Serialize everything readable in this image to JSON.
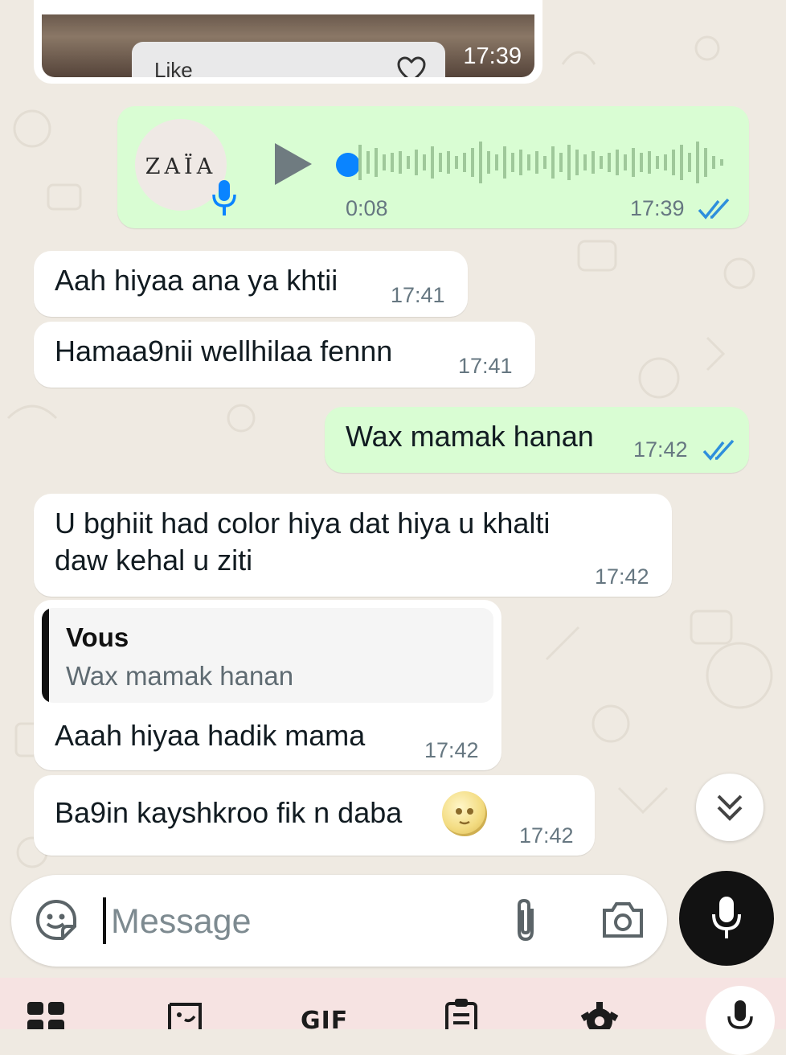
{
  "colors": {
    "chat_bg": "#efeae2",
    "incoming_bubble": "#ffffff",
    "outgoing_bubble": "#d9fdd3",
    "read_ticks": "#53bdeb",
    "voice_progress_dot": "#0a84ff",
    "mic_button": "#121212"
  },
  "image_message": {
    "like_label": "Like",
    "time": "17:39"
  },
  "voice_message": {
    "avatar_text": "ZAÏA",
    "duration": "0:08",
    "time": "17:39",
    "status": "read"
  },
  "messages": [
    {
      "direction": "in",
      "text": "Aah hiyaa ana ya khtii",
      "time": "17:41"
    },
    {
      "direction": "in",
      "text": "Hamaa9nii wellhilaa fennn",
      "time": "17:41"
    },
    {
      "direction": "out",
      "text": "Wax mamak hanan",
      "time": "17:42",
      "status": "read"
    },
    {
      "direction": "in",
      "text_line1": "U bghiit had color hiya dat hiya u khalti",
      "text_line2": "daw kehal u ziti",
      "time": "17:42"
    },
    {
      "direction": "in",
      "reply_to": {
        "author": "Vous",
        "text": "Wax mamak hanan"
      },
      "text": "Aaah hiyaa hadik mama",
      "time": "17:42"
    },
    {
      "direction": "in",
      "text": "Ba9in kayshkroo fik n daba",
      "emoji": "moon-face-emoji",
      "time": "17:42"
    }
  ],
  "composer": {
    "placeholder": "Message",
    "icons": [
      "sticker-icon",
      "attach-icon",
      "camera-icon",
      "mic-icon"
    ]
  },
  "keyboard_toolbar": {
    "gif_label": "GIF",
    "icons": [
      "apps-grid-icon",
      "sticker-icon",
      "gif-icon",
      "clipboard-icon",
      "settings-icon",
      "voice-input-icon"
    ]
  }
}
